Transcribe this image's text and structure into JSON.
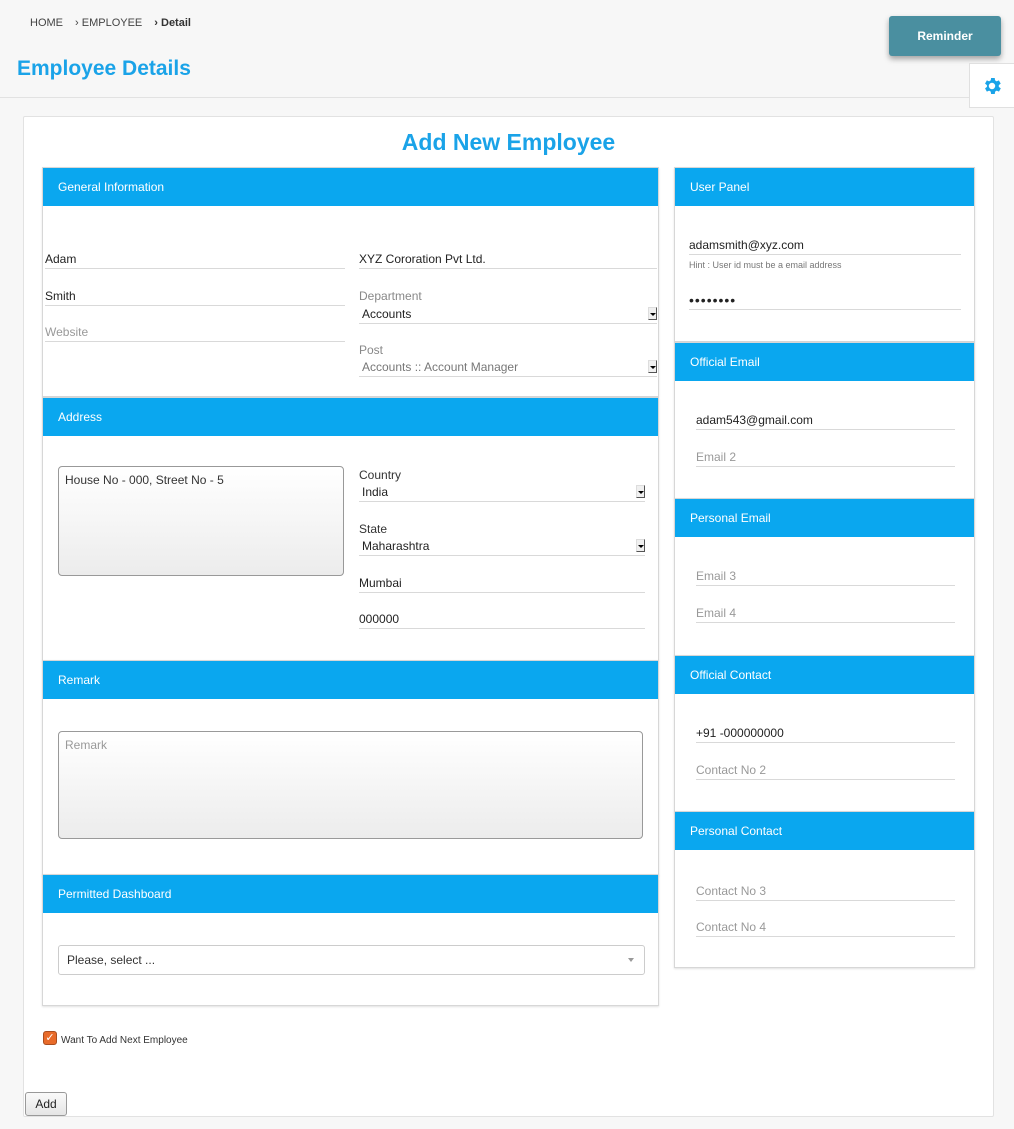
{
  "breadcrumb": {
    "home": "HOME",
    "employee": "EMPLOYEE",
    "detail": "Detail"
  },
  "page_title": "Employee Details",
  "reminder_label": "Reminder",
  "form_title": "Add New Employee",
  "general": {
    "heading": "General Information",
    "first_name": "Adam",
    "last_name": "Smith",
    "website_placeholder": "Website",
    "company": "XYZ Cororation Pvt Ltd.",
    "department_label": "Department",
    "department": "Accounts",
    "post_label": "Post",
    "post": "Accounts :: Account Manager"
  },
  "address": {
    "heading": "Address",
    "street": "House No - 000, Street No - 5",
    "country_label": "Country",
    "country": "India",
    "state_label": "State",
    "state": "Maharashtra",
    "city": "Mumbai",
    "zip": "000000"
  },
  "remark": {
    "heading": "Remark",
    "placeholder": "Remark"
  },
  "dashboard": {
    "heading": "Permitted Dashboard",
    "placeholder": "Please, select ..."
  },
  "user_panel": {
    "heading": "User Panel",
    "user_id": "adamsmith@xyz.com",
    "hint": "Hint : User id must be a email address",
    "password_mask": "••••••••"
  },
  "official_email": {
    "heading": "Official Email",
    "email1": "adam543@gmail.com",
    "email2_placeholder": "Email 2"
  },
  "personal_email": {
    "heading": "Personal Email",
    "email3_placeholder": "Email 3",
    "email4_placeholder": "Email 4"
  },
  "official_contact": {
    "heading": "Official Contact",
    "contact1": "+91 -000000000",
    "contact2_placeholder": "Contact No 2"
  },
  "personal_contact": {
    "heading": "Personal Contact",
    "contact3_placeholder": "Contact No 3",
    "contact4_placeholder": "Contact No 4"
  },
  "next_employee_label": "Want To Add Next Employee",
  "add_label": "Add",
  "colors": {
    "accent": "#0aa7ef",
    "title": "#1aa3e8",
    "reminder": "#4a8fa0",
    "checkbox": "#e86b2a"
  }
}
